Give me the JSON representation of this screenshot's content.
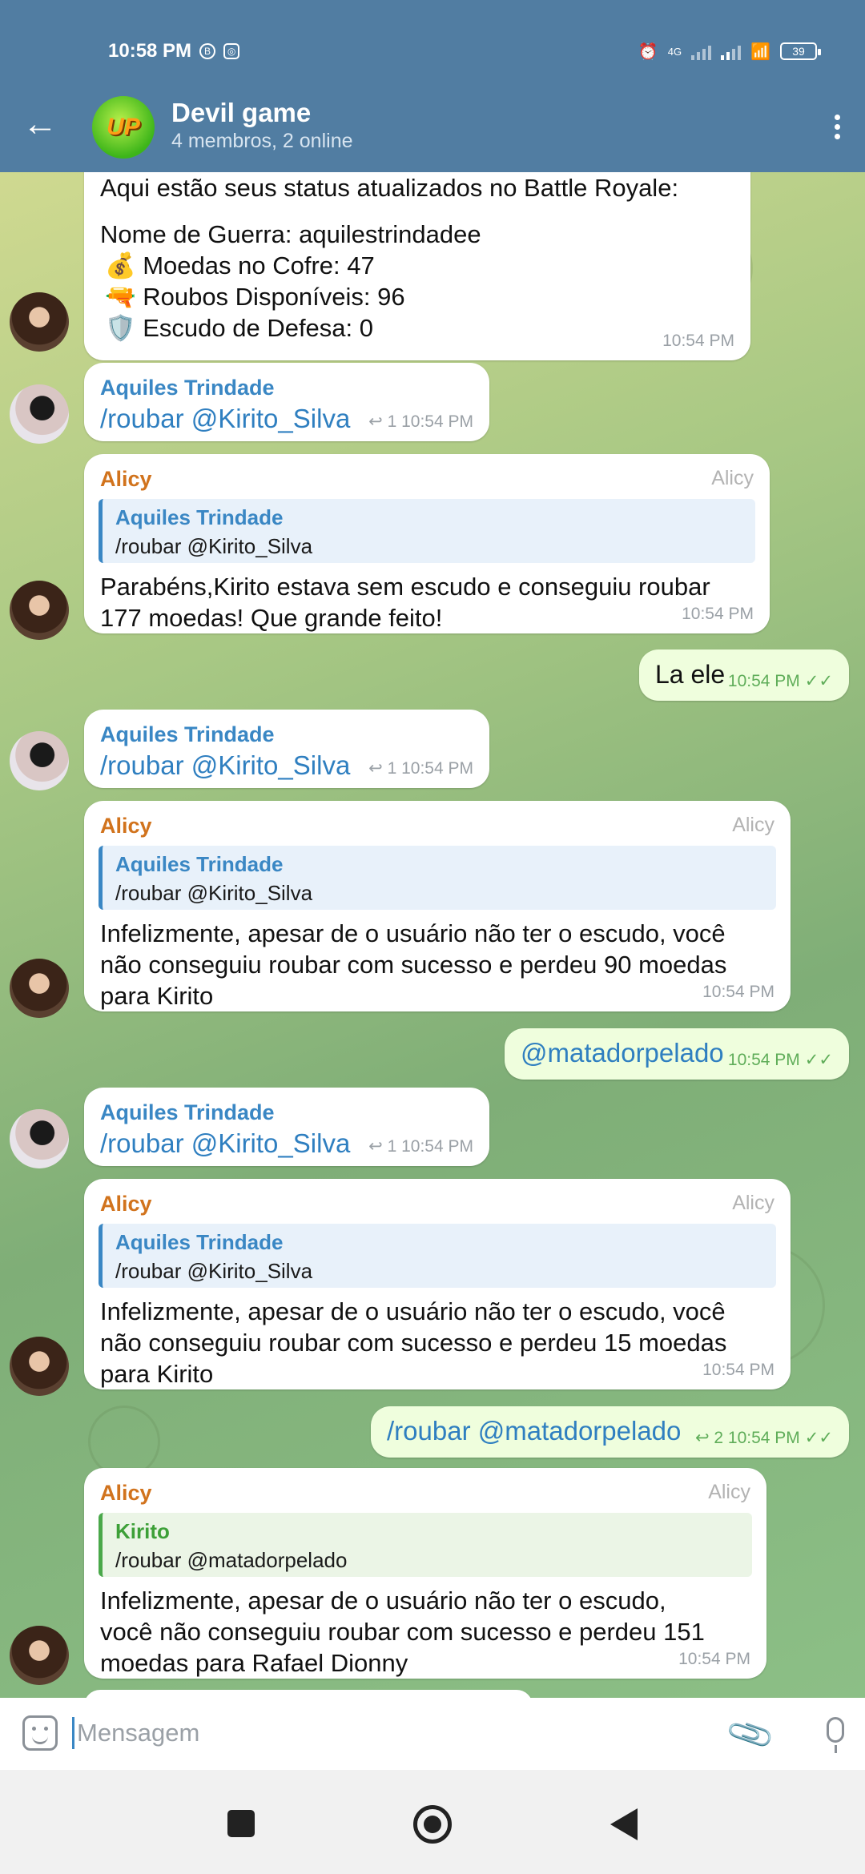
{
  "status_bar": {
    "time": "10:58 PM",
    "network": "4G",
    "battery": "39"
  },
  "header": {
    "title": "Devil game",
    "subtitle": "4 membros, 2 online",
    "avatar_text": "UP"
  },
  "messages": [
    {
      "type": "in_status",
      "top_cut": "Aqui estão seus status atualizados no Battle Royale:",
      "lines": [
        "Nome de Guerra: aquilestrindadee",
        "💰 Moedas no Cofre: 47",
        "🔫 Roubos Disponíveis: 96",
        "🛡️ Escudo de Defesa: 0"
      ],
      "time": "10:54 PM"
    },
    {
      "sender": "Aquiles Trindade",
      "text": "/roubar @Kirito_Silva",
      "replies": "1",
      "time": "10:54 PM"
    },
    {
      "sender": "Alicy",
      "tag": "Alicy",
      "quote_name": "Aquiles Trindade",
      "quote_text": "/roubar @Kirito_Silva",
      "lines": [
        "Parabéns,Kirito estava sem escudo e conseguiu roubar",
        "177 moedas! Que grande feito!"
      ],
      "time": "10:54 PM"
    },
    {
      "text": "La ele",
      "time": "10:54 PM",
      "checks": "✓✓"
    },
    {
      "sender": "Aquiles Trindade",
      "text": "/roubar @Kirito_Silva",
      "replies": "1",
      "time": "10:54 PM"
    },
    {
      "sender": "Alicy",
      "tag": "Alicy",
      "quote_name": "Aquiles Trindade",
      "quote_text": "/roubar @Kirito_Silva",
      "lines": [
        "Infelizmente, apesar de o usuário não ter o escudo, você",
        "não conseguiu roubar com sucesso e perdeu 90 moedas",
        "para Kirito"
      ],
      "time": "10:54 PM"
    },
    {
      "text": "@matadorpelado",
      "time": "10:54 PM",
      "checks": "✓✓"
    },
    {
      "sender": "Aquiles Trindade",
      "text": "/roubar @Kirito_Silva",
      "replies": "1",
      "time": "10:54 PM"
    },
    {
      "sender": "Alicy",
      "tag": "Alicy",
      "quote_name": "Aquiles Trindade",
      "quote_text": "/roubar @Kirito_Silva",
      "lines": [
        "Infelizmente, apesar de o usuário não ter o escudo, você",
        "não conseguiu roubar com sucesso e perdeu 15 moedas",
        "para Kirito"
      ],
      "time": "10:54 PM"
    },
    {
      "text": "/roubar @matadorpelado",
      "replies": "2",
      "time": "10:54 PM",
      "checks": "✓✓"
    },
    {
      "sender": "Alicy",
      "tag": "Alicy",
      "quote_name": "Kirito",
      "quote_text": "/roubar @matadorpelado",
      "lines": [
        "Infelizmente, apesar de o usuário não ter o escudo,",
        "você não conseguiu roubar com sucesso e perdeu 151",
        "moedas para Rafael Dionny"
      ],
      "time": "10:54 PM"
    }
  ],
  "input": {
    "placeholder": "Mensagem"
  },
  "colors": {
    "header": "#517da2",
    "outgoing": "#effedd",
    "link": "#2f7fc0",
    "bot_name": "#d1731d"
  }
}
